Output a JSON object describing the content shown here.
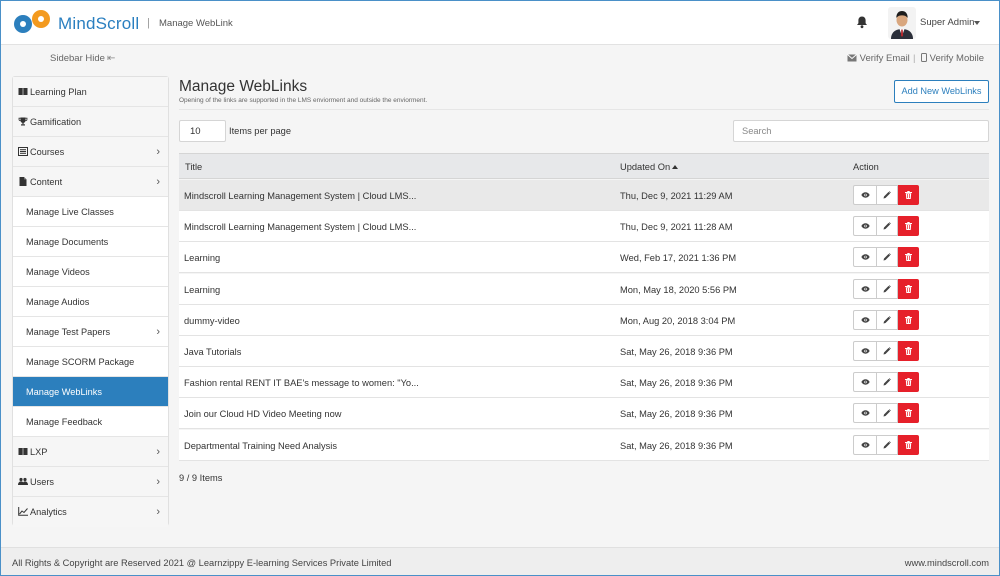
{
  "header": {
    "brand": "MindScroll",
    "separator": "|",
    "page_crumb": "Manage WebLink",
    "user_name": "Super Admin"
  },
  "subbar": {
    "sidebar_hide": "Sidebar Hide",
    "verify_email": "Verify Email",
    "divider": "|",
    "verify_mobile": "Verify Mobile"
  },
  "sidebar": {
    "items": [
      {
        "label": "Learning Plan",
        "icon": "book-icon"
      },
      {
        "label": "Gamification",
        "icon": "trophy-icon"
      },
      {
        "label": "Courses",
        "icon": "list-icon"
      },
      {
        "label": "Content",
        "icon": "file-icon"
      },
      {
        "label": "Manage Live Classes"
      },
      {
        "label": "Manage Documents"
      },
      {
        "label": "Manage Videos"
      },
      {
        "label": "Manage Audios"
      },
      {
        "label": "Manage Test Papers"
      },
      {
        "label": "Manage SCORM Package"
      },
      {
        "label": "Manage WebLinks"
      },
      {
        "label": "Manage Feedback"
      },
      {
        "label": "LXP",
        "icon": "book-icon"
      },
      {
        "label": "Users",
        "icon": "users-icon"
      },
      {
        "label": "Analytics",
        "icon": "chart-icon"
      }
    ]
  },
  "main": {
    "title": "Manage WebLinks",
    "subtitle": "Opening of the links are supported in the LMS enviorment and outside the enviorment.",
    "add_button": "Add New WebLinks",
    "per_page_value": "10",
    "per_page_label": "Items per page",
    "search_placeholder": "Search",
    "columns": {
      "title": "Title",
      "updated": "Updated On",
      "action": "Action"
    },
    "rows": [
      {
        "title": "Mindscroll Learning Management System | Cloud LMS...",
        "updated": "Thu, Dec 9, 2021 11:29 AM"
      },
      {
        "title": "Mindscroll Learning Management System | Cloud LMS...",
        "updated": "Thu, Dec 9, 2021 11:28 AM"
      },
      {
        "title": "Learning",
        "updated": "Wed, Feb 17, 2021 1:36 PM"
      },
      {
        "title": "Learning",
        "updated": "Mon, May 18, 2020 5:56 PM"
      },
      {
        "title": "dummy-video",
        "updated": "Mon, Aug 20, 2018 3:04 PM"
      },
      {
        "title": "Java Tutorials",
        "updated": "Sat, May 26, 2018 9:36 PM"
      },
      {
        "title": "Fashion rental RENT IT BAE's message to women: \"Yo...",
        "updated": "Sat, May 26, 2018 9:36 PM"
      },
      {
        "title": "Join our Cloud HD Video Meeting now",
        "updated": "Sat, May 26, 2018 9:36 PM"
      },
      {
        "title": "Departmental Training Need Analysis",
        "updated": "Sat, May 26, 2018 9:36 PM"
      }
    ],
    "count": "9 / 9 Items"
  },
  "footer": {
    "copyright": "All Rights & Copyright are Reserved 2021 @ Learnzippy E-learning Services Private Limited",
    "site": "www.mindscroll.com"
  },
  "colors": {
    "accent": "#2c7fbd",
    "danger": "#e6202a",
    "logo_orange": "#f39a1f"
  }
}
